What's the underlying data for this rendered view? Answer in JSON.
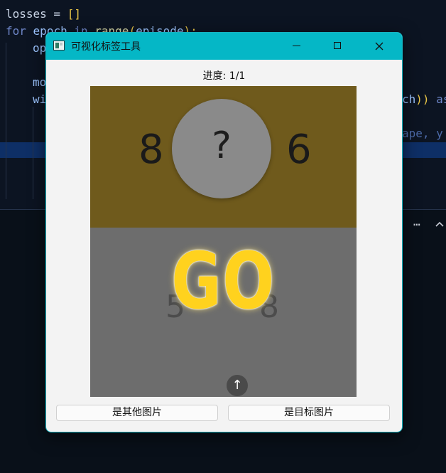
{
  "editor": {
    "lines": [
      {
        "kind": "plain",
        "prefix": "losses = ",
        "bracket": "[]"
      },
      {
        "kind": "for",
        "keyword": "for",
        "var": "epoch",
        "kw_in": "in",
        "fn": "range",
        "arg": "episode",
        "tail": "):"
      },
      {
        "kind": "frag",
        "text": "op"
      },
      {
        "kind": "frag",
        "text": "mo"
      },
      {
        "kind": "frag",
        "text": "wi"
      }
    ],
    "right_fragments": {
      "ch": "ch",
      "paren": ")",
      "close": ")",
      "as": " as",
      "ape": "ape, y"
    },
    "panel_icons": {
      "more": "more-icon",
      "collapse": "chevron-up-icon"
    }
  },
  "window": {
    "title": "可视化标签工具",
    "progress_label": "进度: 1/1",
    "image": {
      "top_left_digit": "8",
      "question": "?",
      "top_right_digit": "6",
      "faint_left": "5",
      "faint_right": "8",
      "overlay_text": "GO",
      "up_arrow": "↑"
    },
    "buttons": {
      "other": "是其他图片",
      "target": "是目标图片"
    }
  },
  "colors": {
    "titlebar": "#05b7c6",
    "image_top": "#6f5a1c",
    "image_bottom": "#6d6d6d",
    "overlay_text": "#ffd21e",
    "editor_bg": "#0c1422",
    "selection": "#0e2f66"
  }
}
